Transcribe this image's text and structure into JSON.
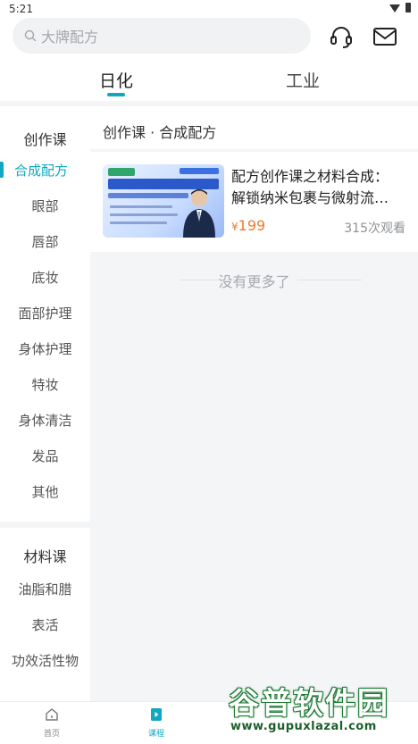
{
  "status_bar": {
    "time": "5:21"
  },
  "search": {
    "placeholder": "大牌配方"
  },
  "top_tabs": [
    {
      "label": "日化",
      "active": true
    },
    {
      "label": "工业",
      "active": false
    }
  ],
  "sidebar": {
    "groups": [
      {
        "header": "创作课",
        "items": [
          "合成配方",
          "眼部",
          "唇部",
          "底妆",
          "面部护理",
          "身体护理",
          "特妆",
          "身体清洁",
          "发品",
          "其他"
        ],
        "active_item": "合成配方"
      },
      {
        "header": "材料课",
        "items": [
          "油脂和腊",
          "表活",
          "功效活性物"
        ]
      }
    ]
  },
  "content": {
    "title": "创作课 · 合成配方",
    "courses": [
      {
        "title_line1": "配方创作课之材料合成：",
        "title_line2": "解锁纳米包裹与微射流…",
        "price_symbol": "¥",
        "price": "199",
        "views": "315次观看"
      }
    ],
    "no_more": "没有更多了"
  },
  "bottom_nav": [
    {
      "label": "首页",
      "icon": "home-icon",
      "active": false
    },
    {
      "label": "课程",
      "icon": "course-play-icon",
      "active": true
    }
  ],
  "watermark": {
    "title": "谷普软件园",
    "url": "www.gupuxlazal.com"
  },
  "colors": {
    "accent": "#10a8c0",
    "price": "#f07a30",
    "background": "#f4f5f7"
  }
}
